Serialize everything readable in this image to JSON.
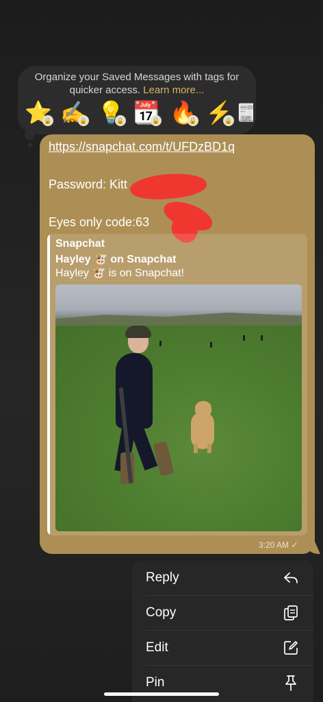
{
  "tip": {
    "text": "Organize your Saved Messages with tags for quicker access.",
    "link": "Learn more..."
  },
  "tag_emojis": [
    "⭐",
    "✍️",
    "💡",
    "📆",
    "🔥",
    "⚡",
    "📰"
  ],
  "message": {
    "link": "https://snapchat.com/t/UFDzBD1q",
    "password_line": "Password: Kitt",
    "eyes_code_line": "Eyes only code:63",
    "time": "3:20 AM",
    "status_icon": "checkmark-icon",
    "preview": {
      "site": "Snapchat",
      "title": "Hayley 🐮 on Snapchat",
      "description": "Hayley 🐮 is on Snapchat!"
    }
  },
  "menu": {
    "items": [
      {
        "label": "Reply",
        "icon": "reply-icon"
      },
      {
        "label": "Copy",
        "icon": "copy-icon"
      },
      {
        "label": "Edit",
        "icon": "edit-icon"
      },
      {
        "label": "Pin",
        "icon": "pin-icon"
      }
    ]
  },
  "colors": {
    "bubble": "#ad8f55",
    "accent_link": "#d8b46a",
    "redaction": "#f0372f"
  }
}
